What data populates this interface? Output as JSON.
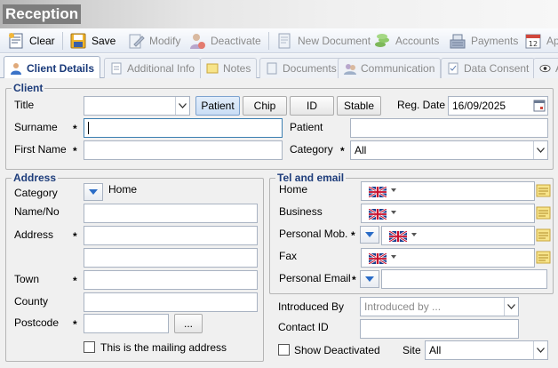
{
  "window": {
    "title": "Reception"
  },
  "toolbar": {
    "clear": "Clear",
    "save": "Save",
    "modify": "Modify",
    "deactivate": "Deactivate",
    "new_document": "New Document",
    "accounts": "Accounts",
    "payments": "Payments",
    "appointments_partial": "Ap"
  },
  "tabs": [
    {
      "label": "Client Details",
      "active": true
    },
    {
      "label": "Additional Info"
    },
    {
      "label": "Notes"
    },
    {
      "label": "Documents"
    },
    {
      "label": "Communication"
    },
    {
      "label": "Data Consent"
    },
    {
      "label": "A"
    }
  ],
  "client": {
    "legend": "Client",
    "title_label": "Title",
    "title_value": "",
    "type_buttons": [
      "Patient",
      "Chip",
      "ID",
      "Stable"
    ],
    "reg_date_label": "Reg. Date",
    "reg_date_value": "16/09/2025",
    "surname_label": "Surname",
    "surname_value": "",
    "patient_label": "Patient",
    "patient_value": "",
    "first_name_label": "First Name",
    "first_name_value": "",
    "category_label": "Category",
    "category_value": "All"
  },
  "address": {
    "legend": "Address",
    "category_label": "Category",
    "category_value": "Home",
    "name_no_label": "Name/No",
    "address_label": "Address",
    "town_label": "Town",
    "county_label": "County",
    "postcode_label": "Postcode",
    "lookup_button": "...",
    "mailing_label": "This is the mailing address"
  },
  "tel": {
    "legend": "Tel and email",
    "home_label": "Home",
    "business_label": "Business",
    "personal_mob_label": "Personal Mob.",
    "fax_label": "Fax",
    "personal_email_label": "Personal Email"
  },
  "footer": {
    "introduced_by_label": "Introduced By",
    "introduced_by_placeholder": "Introduced by ...",
    "contact_id_label": "Contact ID",
    "show_deactivated_label": "Show Deactivated",
    "site_label": "Site",
    "site_value": "All"
  },
  "required_marker": "*",
  "colors": {
    "accent": "#1e3d7b",
    "tab_active_text": "#1a3a7a",
    "focus_border": "#3c7fb1"
  }
}
